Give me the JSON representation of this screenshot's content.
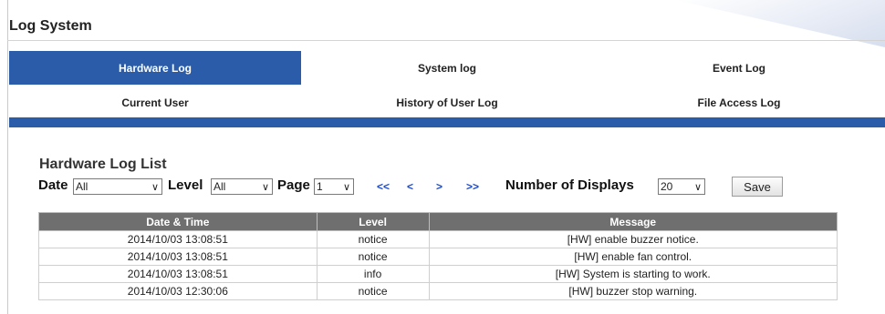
{
  "page": {
    "title": "Log System"
  },
  "tabs": [
    {
      "label": "Hardware Log",
      "active": true
    },
    {
      "label": "System log",
      "active": false
    },
    {
      "label": "Event Log",
      "active": false
    },
    {
      "label": "Current User",
      "active": false
    },
    {
      "label": "History of User Log",
      "active": false
    },
    {
      "label": "File Access Log",
      "active": false
    }
  ],
  "list": {
    "title": "Hardware Log List"
  },
  "filters": {
    "date_label": "Date",
    "date_value": "All",
    "level_label": "Level",
    "level_value": "All",
    "page_label": "Page",
    "page_value": "1",
    "nav_first": "<<",
    "nav_prev": "<",
    "nav_next": ">",
    "nav_last": ">>",
    "displays_label": "Number of Displays",
    "displays_value": "20",
    "save_label": "Save"
  },
  "table": {
    "columns": [
      "Date & Time",
      "Level",
      "Message"
    ],
    "rows": [
      [
        "2014/10/03 13:08:51",
        "notice",
        "[HW] enable buzzer notice."
      ],
      [
        "2014/10/03 13:08:51",
        "notice",
        "[HW] enable fan control."
      ],
      [
        "2014/10/03 13:08:51",
        "info",
        "[HW] System is starting to work."
      ],
      [
        "2014/10/03 12:30:06",
        "notice",
        "[HW] buzzer stop warning."
      ]
    ]
  },
  "colors": {
    "accent": "#2a5ca9",
    "header_bg": "#6f6f6f",
    "nav_link": "#1a49c7"
  }
}
